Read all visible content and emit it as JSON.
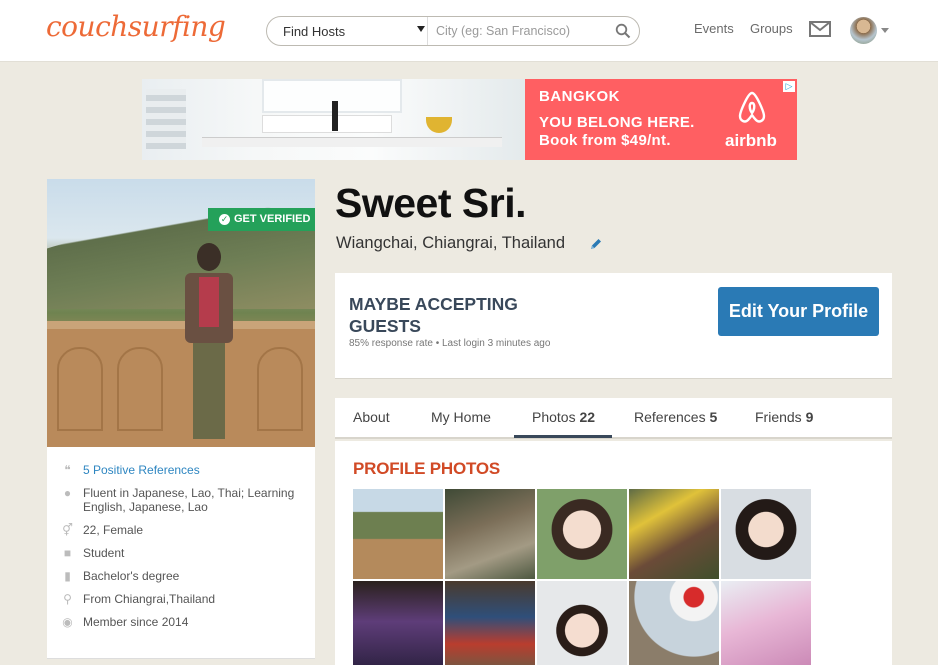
{
  "header": {
    "logo": "couchsurfing",
    "search_mode": "Find Hosts",
    "search_placeholder": "City (eg: San Francisco)",
    "nav_events": "Events",
    "nav_groups": "Groups"
  },
  "ad": {
    "city": "BANGKOK",
    "line1": "YOU BELONG HERE.",
    "line2": "Book from $49/nt.",
    "brand": "airbnb",
    "brand_color": "#ff5f62"
  },
  "profile": {
    "verified_label": "GET VERIFIED",
    "name": "Sweet Sri.",
    "location": "Wiangchai, Chiangrai, Thailand",
    "status": "MAYBE ACCEPTING GUESTS",
    "meta": "85% response rate • Last login 3 minutes ago",
    "edit_label": "Edit Your Profile",
    "facts": [
      {
        "icon": "quote-icon",
        "text": "5 Positive References"
      },
      {
        "icon": "speech-bubble-icon",
        "text": "Fluent in Japanese, Lao, Thai; Learning English, Japanese, Lao"
      },
      {
        "icon": "gender-icon",
        "text": "22, Female"
      },
      {
        "icon": "briefcase-icon",
        "text": "Student"
      },
      {
        "icon": "book-icon",
        "text": "Bachelor's degree"
      },
      {
        "icon": "location-pin-icon",
        "text": "From Chiangrai,Thailand"
      },
      {
        "icon": "member-icon",
        "text": "Member since 2014"
      }
    ]
  },
  "tabs": [
    {
      "label": "About",
      "count": ""
    },
    {
      "label": "My Home",
      "count": ""
    },
    {
      "label": "Photos",
      "count": "22"
    },
    {
      "label": "References",
      "count": "5"
    },
    {
      "label": "Friends",
      "count": "9"
    }
  ],
  "photos": {
    "title": "PROFILE PHOTOS"
  },
  "colors": {
    "accent_blue": "#2a7ab5",
    "verified_green": "#24a15a",
    "section_orange": "#d14a26",
    "logo_orange": "#ed6a37"
  }
}
